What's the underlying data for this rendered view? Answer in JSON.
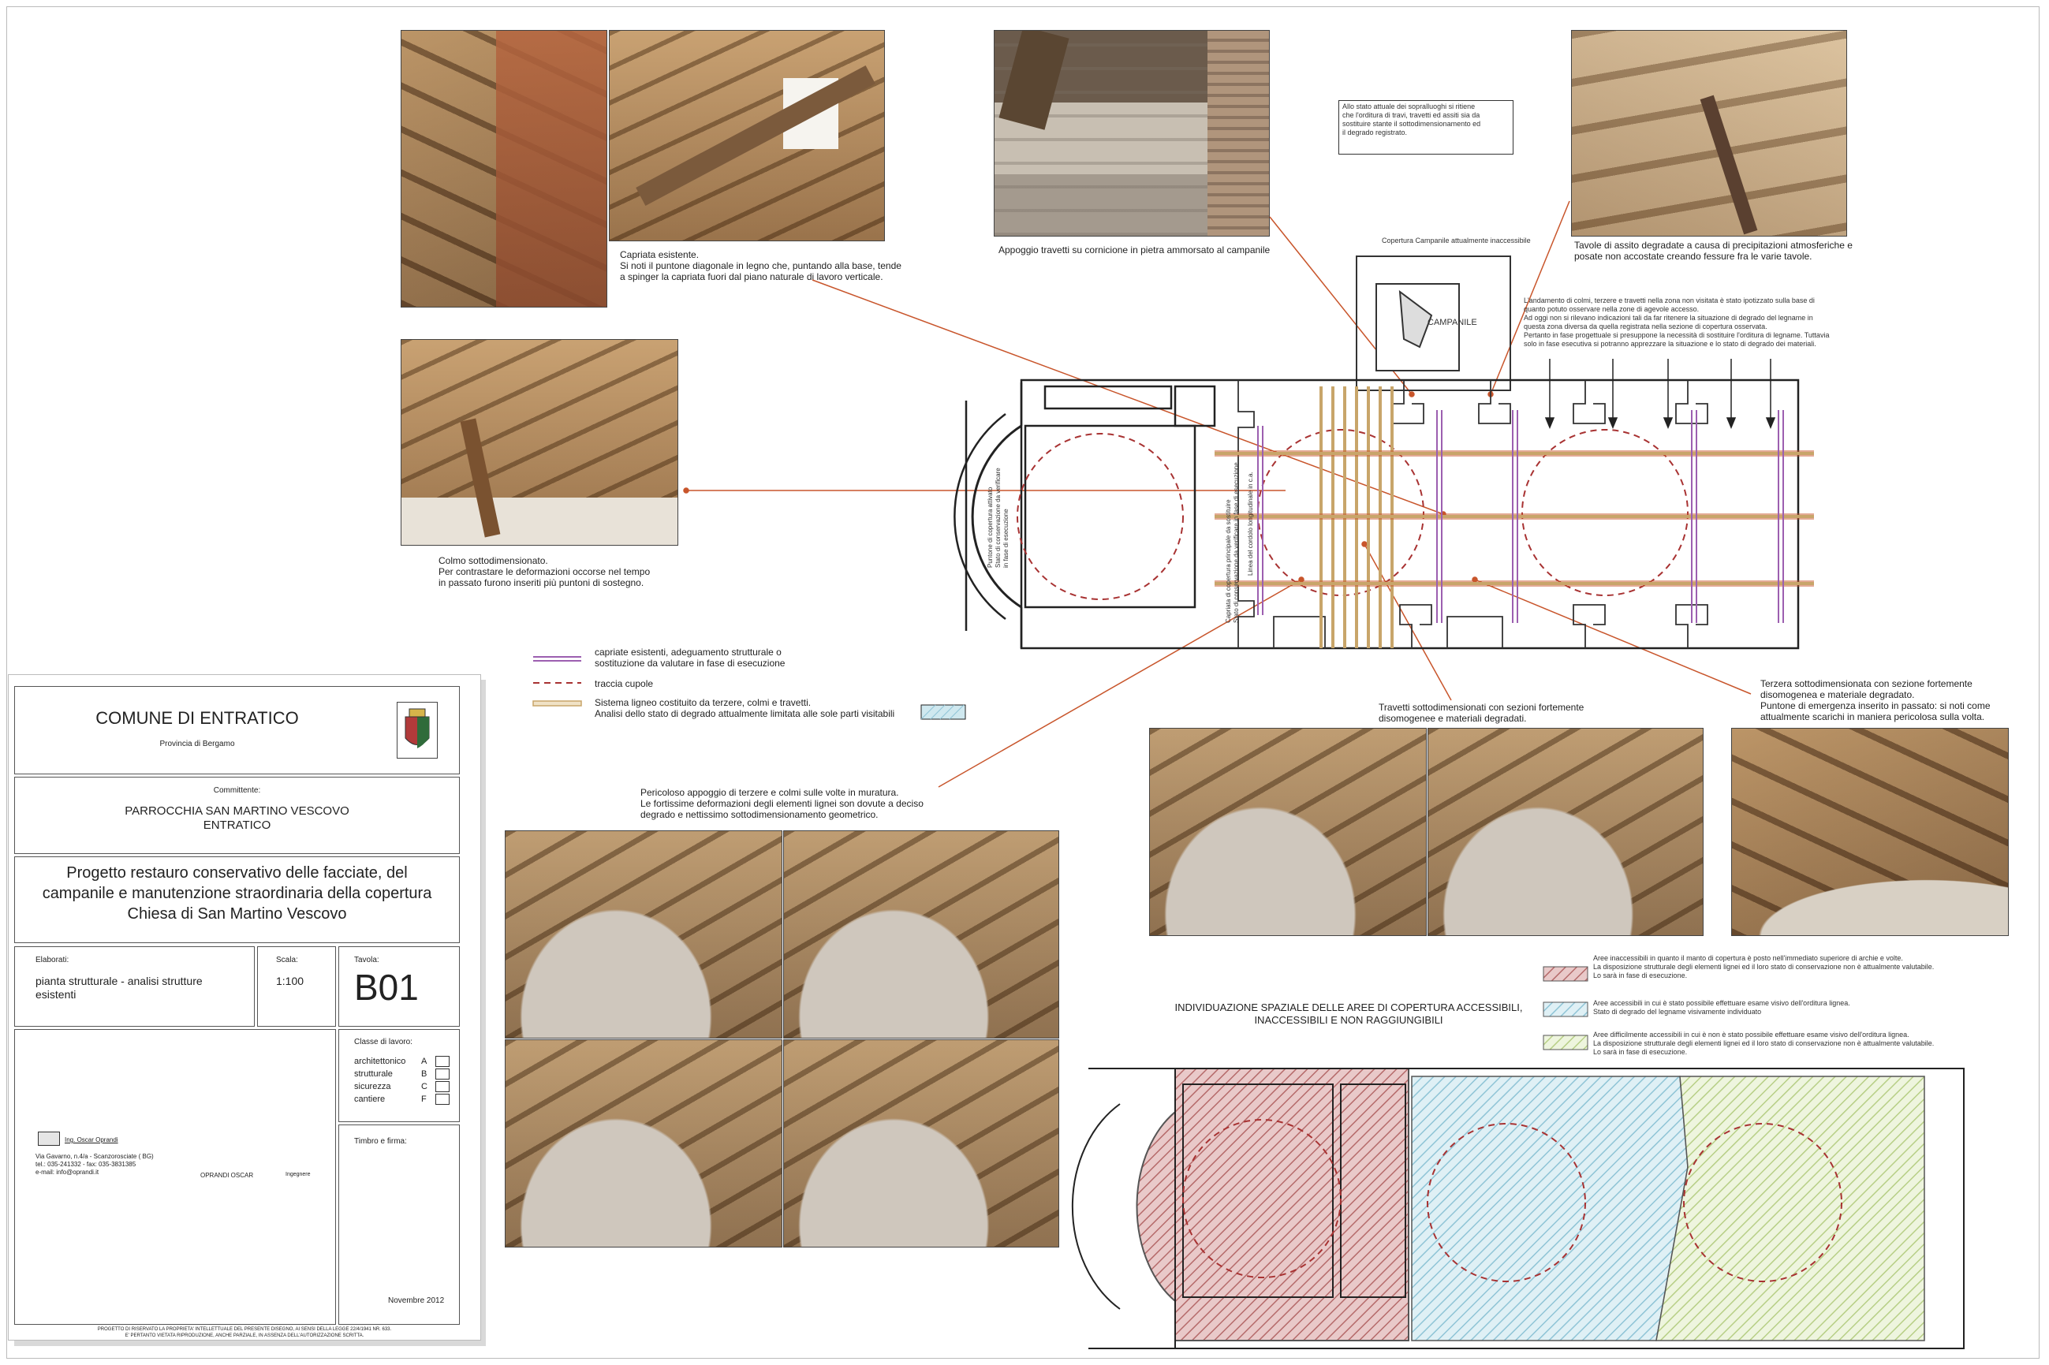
{
  "photos": {
    "capriata_caption": "Capriata esistente.\nSi noti il puntone diagonale in legno che, puntando alla base, tende\na spinger la capriata fuori dal piano naturale di lavoro verticale.",
    "appoggio_caption": "Appoggio travetti su cornicione in pietra ammorsato al campanile",
    "tavole_caption": "Tavole di assito degradate a causa di precipitazioni atmosferiche e\nposate non accostate creando fessure fra le varie tavole.",
    "colmo_caption": "Colmo sottodimensionato.\nPer contrastare le deformazioni occorse nel tempo\nin passato furono inseriti più puntoni di sostegno.",
    "pericoloso_caption": "Pericoloso appoggio di terzere e colmi sulle volte in muratura.\nLe fortissime deformazioni degli elementi lignei son dovute a deciso\ndegrado e nettissimo sottodimensionamento geometrico.",
    "travetti_caption": "Travetti sottodimensionati con sezioni fortemente\ndisomogenee e materiali degradati.",
    "terzera_caption": "Terzera sottodimensionata con sezione fortemente\ndisomogenea e materiale degradato.\nPuntone di emergenza inserito in passato: si noti come\nattualmente scarichi in maniera pericolosa sulla volta."
  },
  "notes": {
    "stato_attuale": "Allo stato attuale dei sopralluoghi si ritiene\nche l'orditura di travi, travetti ed assiti sia da\nsostituire stante il sottodimensionamento ed\nil degrado registrato.",
    "copertura_campanile": "Copertura Campanile attualmente inaccessibile",
    "campanile": "CAMPANILE",
    "andamento": "L'andamento di colmi, terzere e travetti nella zona non visitata è stato ipotizzato sulla base di\nquanto potuto osservare nella zone di agevole accesso.\nAd oggi non si rilevano indicazioni tali da far ritenere la situazione di degrado del legname in\nquesta zona diversa da quella registrata nella sezione di copertura osservata.\nPertanto in fase progettuale si presuppone la necessità di sostituire l'orditura di legname. Tuttavia\nsolo in fase esecutiva si potranno apprezzare la situazione e lo stato di degrado dei materiali.",
    "puntone_cop": "Puntone di copertura attivato\nStato di conservazione da verificare\nin fase di esecuzione",
    "linea_cordolo": "Linea del cordolo longitudinale in c.a.",
    "capriata_stato": "Capriata di copertura principale da sostituire\nStato di conservazione da verificare in fase di esecuzione"
  },
  "legend_top": {
    "capriate": "capriate esistenti, adeguamento strutturale o\nsostituzione da valutare in fase di esecuzione",
    "traccia": "traccia cupole",
    "sistema": "Sistema ligneo costituito da terzere, colmi e travetti.\nAnalisi dello stato di degrado attualmente limitata alle sole parti visitabili"
  },
  "zones": {
    "title": "INDIVIDUAZIONE SPAZIALE DELLE AREE DI COPERTURA ACCESSIBILI,\nINACCESSIBILI E NON RAGGIUNGIBILI",
    "red": "Aree inaccessibili in quanto il manto di copertura è posto nell'immediato superiore di archie e volte.\nLa disposizione strutturale degli elementi lignei ed il loro stato di conservazione non è attualmente valutabile.\nLo sarà in fase di esecuzione.",
    "blue": "Aree accessibili in cui è stato possibile effettuare esame visivo dell'orditura lignea.\nStato di degrado del legname visivamente individuato",
    "green": "Aree difficilmente accessibili in cui è non è stato possibile effettuare esame visivo dell'orditura lignea.\nLa disposizione strutturale degli elementi lignei ed il loro stato di conservazione non è attualmente valutabile.\nLo sarà in fase di esecuzione.",
    "colors": {
      "red": "#b56a6a",
      "blue": "#8fc4d6",
      "green": "#b7cf86"
    }
  },
  "title_block": {
    "comune": "COMUNE DI ENTRATICO",
    "provincia": "Provincia di Bergamo",
    "committente_label": "Committente:",
    "committente": "PARROCCHIA SAN MARTINO VESCOVO\nENTRATICO",
    "progetto": "Progetto restauro conservativo delle facciate, del\ncampanile e manutenzione straordinaria della copertura\nChiesa di San Martino Vescovo",
    "elaborati_label": "Elaborati:",
    "elaborati": "pianta strutturale - analisi strutture\nesistenti",
    "scala_label": "Scala:",
    "scala": "1:100",
    "tavola_label": "Tavola:",
    "tavola": "B01",
    "classe_label": "Classe di lavoro:",
    "classi": [
      {
        "name": "architettonico",
        "code": "A"
      },
      {
        "name": "strutturale",
        "code": "B"
      },
      {
        "name": "sicurezza",
        "code": "C"
      },
      {
        "name": "cantiere",
        "code": "F"
      }
    ],
    "timbro_label": "Timbro e firma:",
    "ing_logo": "Ing. Oscar Oprandi",
    "studio": "Via Gavarno, n.4/a - Scanzorosciate ( BG)\ntel.: 035-241332 - fax: 035-3831385\ne-mail: info@oprandi.it",
    "firmatario": "OPRANDI OSCAR",
    "qualifica": "Ingegnere",
    "data": "Novembre 2012",
    "copyright": "PROGETTO DI RISERVATO LA PROPRIETA' INTELLETTUALE DEL PRESENTE DISEGNO, AI SENSI DELLA LEGGE 22/4/1941 NR. 633.\nE' PERTANTO VIETATA RIPRODUZIONE, ANCHE PARZIALE, IN ASSENZA DELL'AUTORIZZAZIONE SCRITTA."
  }
}
